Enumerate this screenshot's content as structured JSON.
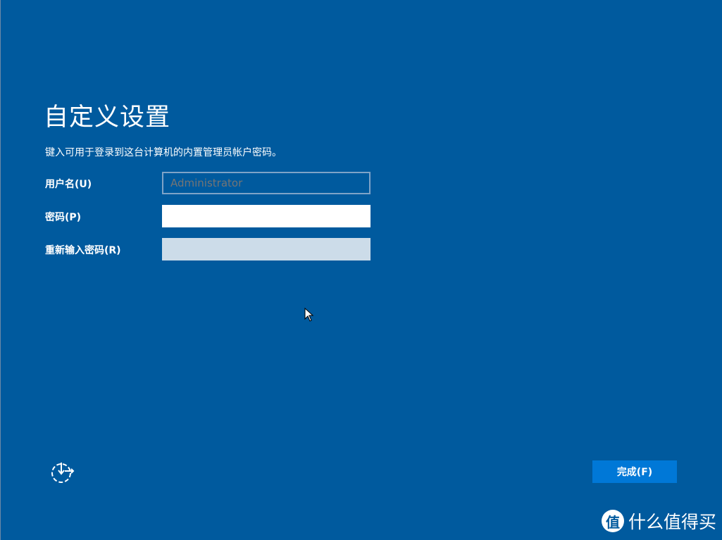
{
  "page": {
    "title": "自定义设置",
    "description": "键入可用于登录到这台计算机的内置管理员帐户密码。"
  },
  "form": {
    "username_label": "用户名(U)",
    "username_placeholder": "Administrator",
    "password_label": "密码(P)",
    "password_value": "",
    "reenter_label": "重新输入密码(R)",
    "reenter_value": ""
  },
  "footer": {
    "accessibility_icon": "ease-of-access-icon",
    "finish_label": "完成(F)"
  },
  "watermark": {
    "logo_char": "值",
    "text": "什么值得买"
  },
  "colors": {
    "background": "#005a9e",
    "button": "#0078d7"
  }
}
